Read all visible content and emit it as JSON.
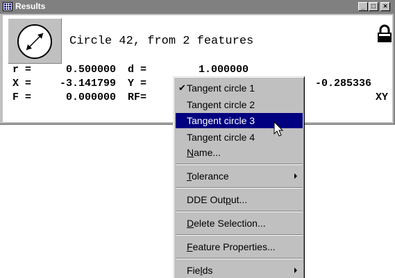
{
  "window": {
    "title": "Results"
  },
  "feature": {
    "title": "Circle 42, from 2 features"
  },
  "values": {
    "row1": {
      "r_label": "r =",
      "r_value": "0.500000",
      "d_label": "d =",
      "d_value": "1.000000"
    },
    "row2": {
      "x_label": "X =",
      "x_value": "-3.141799",
      "y_label": "Y =",
      "y_value": "-0.285336"
    },
    "row3": {
      "f_label": "F =",
      "f_value": "0.000000",
      "rf_label": "RF=",
      "plane": "XY"
    }
  },
  "menu": {
    "items": [
      {
        "label": "Tangent circle 1",
        "checked": true
      },
      {
        "label": "Tangent circle 2"
      },
      {
        "label": "Tangent circle 3",
        "selected": true
      },
      {
        "label": "Tangent circle 4"
      },
      {
        "label_pre": "",
        "label_ul": "N",
        "label_post": "ame..."
      },
      {
        "label_pre": "",
        "label_ul": "T",
        "label_post": "olerance",
        "submenu": true
      },
      {
        "label_pre": "DDE Out",
        "label_ul": "p",
        "label_post": "ut..."
      },
      {
        "label_pre": "",
        "label_ul": "D",
        "label_post": "elete Selection..."
      },
      {
        "label_pre": "",
        "label_ul": "F",
        "label_post": "eature Properties..."
      },
      {
        "label_pre": "Fie",
        "label_ul": "l",
        "label_post": "ds",
        "submenu": true
      }
    ],
    "check_glyph": "✔"
  },
  "titlebar_buttons": {
    "minimize": "_",
    "maximize": "□",
    "close": "×"
  }
}
